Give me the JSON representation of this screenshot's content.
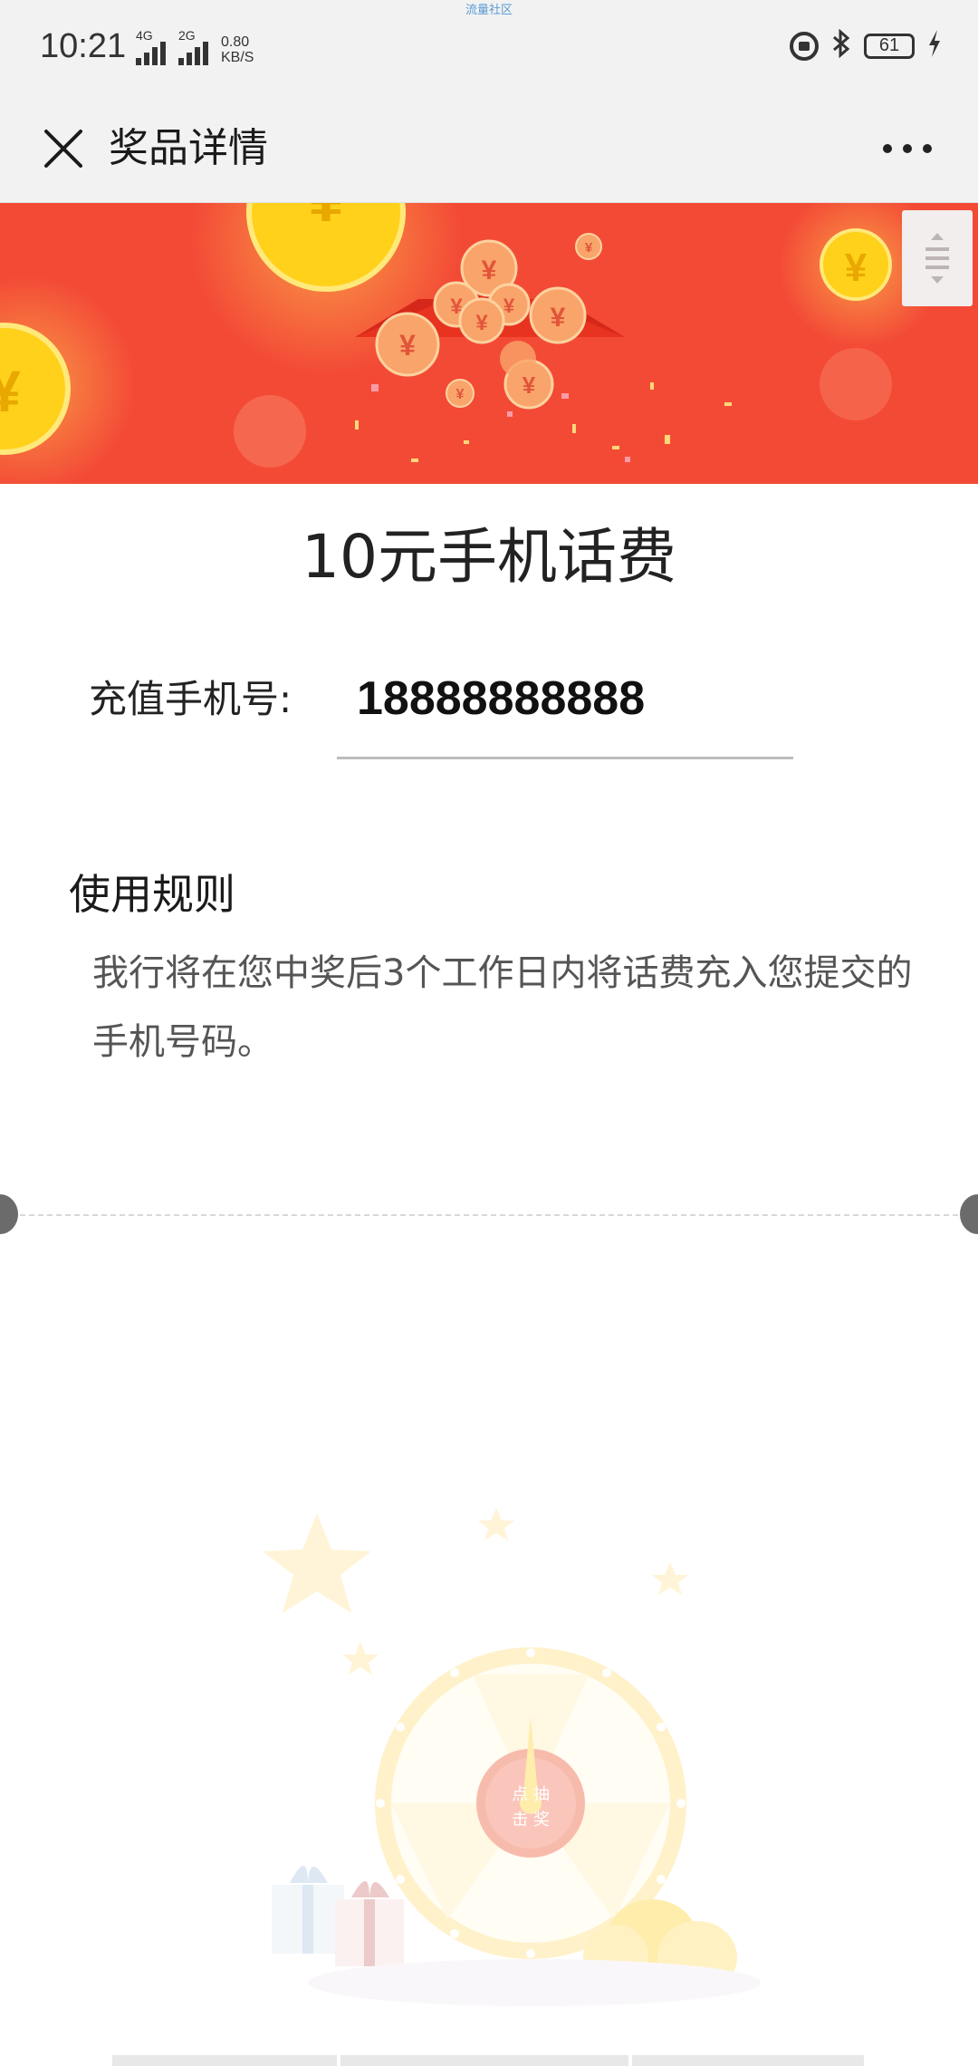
{
  "status_bar": {
    "time": "10:21",
    "network_top_label": "流量社区",
    "signal_1_label": "4G",
    "signal_2_label": "2G",
    "speed_value": "0.80",
    "speed_unit": "KB/S",
    "battery_level": "61",
    "icons": [
      "lock-rotation-icon",
      "bluetooth-icon",
      "battery-icon",
      "charging-icon"
    ]
  },
  "titlebar": {
    "title": "奖品详情",
    "close_icon": "close-icon",
    "more_icon": "more-icon"
  },
  "prize": {
    "name": "10元手机话费",
    "phone_label": "充值手机号:",
    "phone_number": "18888888888"
  },
  "rules": {
    "title": "使用规则",
    "body": "我行将在您中奖后3个工作日内将话费充入您提交的手机号码。"
  },
  "wheel": {
    "button_text": "点击抽奖"
  },
  "colors": {
    "banner_red": "#f34a36",
    "coin_gold": "#ffd11a",
    "background": "#ffffff"
  }
}
